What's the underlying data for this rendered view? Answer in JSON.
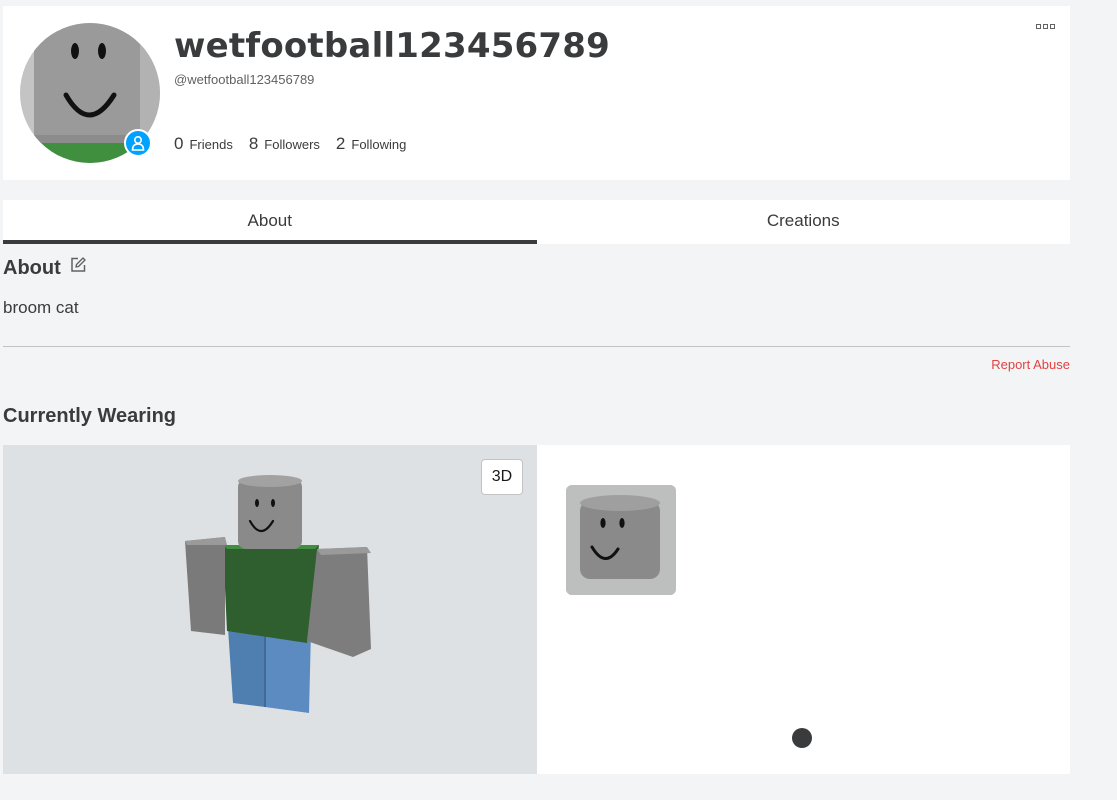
{
  "profile": {
    "display_name": "wetfootball123456789",
    "username": "@wetfootball123456789",
    "stats": [
      {
        "count": "0",
        "label": "Friends"
      },
      {
        "count": "8",
        "label": "Followers"
      },
      {
        "count": "2",
        "label": "Following"
      }
    ],
    "presence_color": "#00a2ff"
  },
  "tabs": [
    {
      "label": "About",
      "active": true
    },
    {
      "label": "Creations",
      "active": false
    }
  ],
  "about": {
    "heading": "About",
    "bio": "broom cat",
    "report_label": "Report Abuse"
  },
  "wearing": {
    "heading": "Currently Wearing",
    "view_toggle_label": "3D",
    "items": [
      {
        "icon": "smiley-head-icon"
      }
    ]
  },
  "colors": {
    "accent": "#00a2ff",
    "report": "#e24343",
    "torso": "#2f5f2f",
    "legs": "#4f7fb0",
    "skin": "#8a8a8a"
  }
}
